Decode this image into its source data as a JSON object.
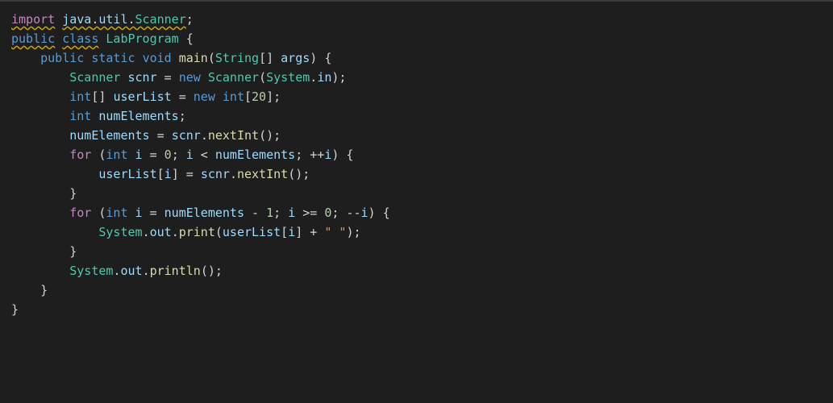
{
  "chart_data": null,
  "code": {
    "line1": {
      "import": "import",
      "pkg1": "java",
      "pkg2": "util",
      "cls": "Scanner",
      "semi": ";"
    },
    "line2": {
      "public": "public",
      "class": "class",
      "name": "LabProgram",
      "brace": " {"
    },
    "line3": {
      "indent": "    ",
      "public": "public",
      "static": "static",
      "void": "void",
      "main": "main",
      "params_open": "(",
      "type": "String",
      "brackets": "[] ",
      "arg": "args",
      "params_close": ") {"
    },
    "line4": {
      "indent": "        ",
      "type": "Scanner",
      "var": "scnr",
      "eq": " = ",
      "new": "new",
      "ctor": "Scanner",
      "open": "(",
      "sys": "System",
      "dot": ".",
      "in": "in",
      "close": ");"
    },
    "line5": {
      "indent": "        ",
      "type": "int",
      "brackets": "[] ",
      "var": "userList",
      "eq": " = ",
      "new": "new",
      "type2": "int",
      "open": "[",
      "num": "20",
      "close": "];"
    },
    "line6": {
      "indent": "        ",
      "type": "int",
      "var": "numElements",
      "semi": ";"
    },
    "line7": {
      "indent": "        ",
      "var": "numElements",
      "eq": " = ",
      "obj": "scnr",
      "dot": ".",
      "method": "nextInt",
      "call": "();"
    },
    "line8": {
      "indent": "        ",
      "for": "for",
      "open": " (",
      "type": "int",
      "var": "i",
      "eq": " = ",
      "zero": "0",
      "semi1": "; ",
      "var2": "i",
      "lt": " < ",
      "var3": "numElements",
      "semi2": "; ++",
      "var4": "i",
      "close": ") {"
    },
    "line9": {
      "indent": "            ",
      "arr": "userList",
      "open": "[",
      "idx": "i",
      "close": "] = ",
      "obj": "scnr",
      "dot": ".",
      "method": "nextInt",
      "call": "();"
    },
    "line10": {
      "indent": "        ",
      "brace": "}"
    },
    "line11": {
      "indent": "        ",
      "for": "for",
      "open": " (",
      "type": "int",
      "var": "i",
      "eq": " = ",
      "var2": "numElements",
      "minus": " - ",
      "one": "1",
      "semi1": "; ",
      "var3": "i",
      "gte": " >= ",
      "zero": "0",
      "semi2": "; --",
      "var4": "i",
      "close": ") {"
    },
    "line12": {
      "indent": "            ",
      "sys": "System",
      "dot1": ".",
      "out": "out",
      "dot2": ".",
      "method": "print",
      "open": "(",
      "arr": "userList",
      "bopen": "[",
      "idx": "i",
      "bclose": "] + ",
      "str": "\" \"",
      "close": ");"
    },
    "line13": {
      "indent": "        ",
      "brace": "}"
    },
    "line14": {
      "indent": "        ",
      "sys": "System",
      "dot1": ".",
      "out": "out",
      "dot2": ".",
      "method": "println",
      "call": "();"
    },
    "line15": {
      "indent": "    ",
      "brace": "}"
    },
    "line16": {
      "brace": "}"
    }
  }
}
